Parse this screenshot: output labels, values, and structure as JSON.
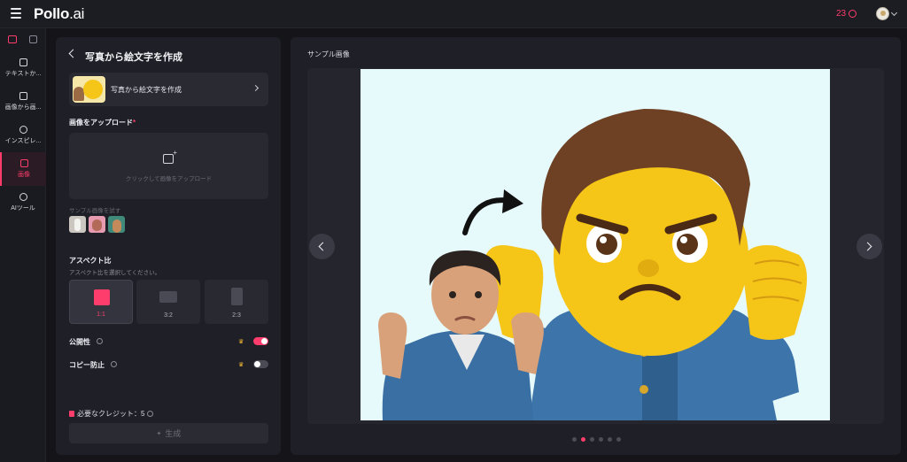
{
  "app": {
    "logo_main": "Pollo",
    "logo_suffix": ".ai",
    "credits": "23"
  },
  "rail": {
    "items": [
      {
        "label": "テキストか..."
      },
      {
        "label": "画像から画..."
      },
      {
        "label": "インスピレ..."
      },
      {
        "label": "画像"
      },
      {
        "label": "AIツール"
      }
    ]
  },
  "form": {
    "title": "写真から絵文字を作成",
    "tool_card_label": "写真から絵文字を作成",
    "upload_label": "画像をアップロード",
    "required_mark": "*",
    "upload_hint": "クリックして画像をアップロード",
    "sample_label": "サンプル画像を試す",
    "aspect_title": "アスペクト比",
    "aspect_subtitle": "アスペクト比を選択してください。",
    "ratios": [
      "1:1",
      "3:2",
      "2:3"
    ],
    "selected_ratio": "1:1",
    "public_label": "公開性",
    "public_on": true,
    "copy_protect_label": "コピー防止",
    "copy_protect_on": false,
    "credits_required": "必要なクレジット：5",
    "generate_label": "生成"
  },
  "preview": {
    "title": "サンプル画像",
    "slide_count": 6,
    "active_slide": 2
  },
  "colors": {
    "accent": "#ff3d6c",
    "panel": "#1f1f27",
    "background": "#141419"
  }
}
